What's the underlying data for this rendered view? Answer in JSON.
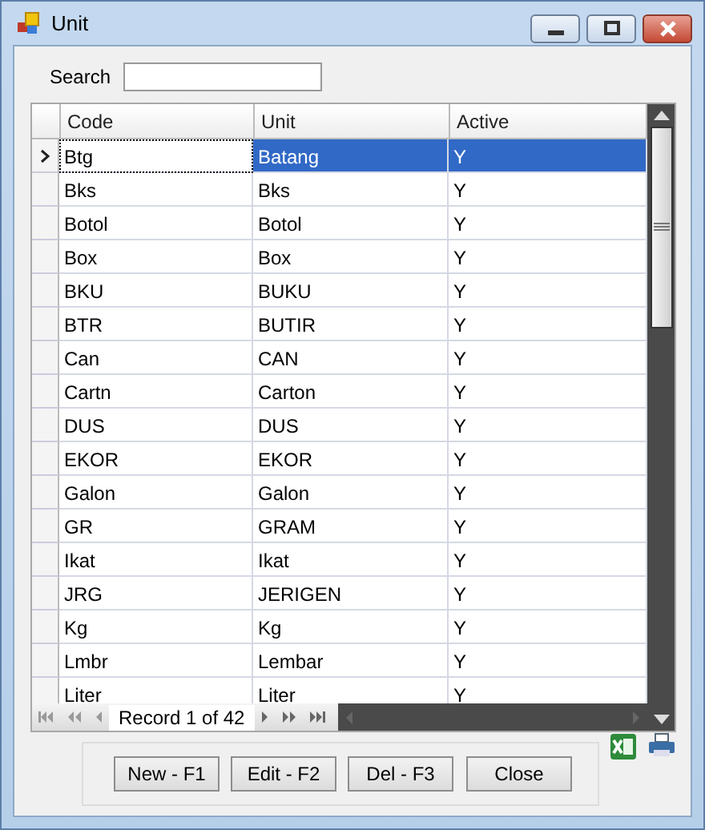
{
  "window": {
    "title": "Unit"
  },
  "search": {
    "label": "Search"
  },
  "table": {
    "columns": [
      "Code",
      "Unit",
      "Active"
    ],
    "rows": [
      {
        "cells": [
          "Btg",
          "Batang",
          "Y"
        ],
        "selected": true
      },
      {
        "cells": [
          "Bks",
          "Bks",
          "Y"
        ],
        "selected": false
      },
      {
        "cells": [
          "Botol",
          "Botol",
          "Y"
        ],
        "selected": false
      },
      {
        "cells": [
          "Box",
          "Box",
          "Y"
        ],
        "selected": false
      },
      {
        "cells": [
          "BKU",
          "BUKU",
          "Y"
        ],
        "selected": false
      },
      {
        "cells": [
          "BTR",
          "BUTIR",
          "Y"
        ],
        "selected": false
      },
      {
        "cells": [
          "Can",
          "CAN",
          "Y"
        ],
        "selected": false
      },
      {
        "cells": [
          "Cartn",
          "Carton",
          "Y"
        ],
        "selected": false
      },
      {
        "cells": [
          "DUS",
          "DUS",
          "Y"
        ],
        "selected": false
      },
      {
        "cells": [
          "EKOR",
          "EKOR",
          "Y"
        ],
        "selected": false
      },
      {
        "cells": [
          "Galon",
          "Galon",
          "Y"
        ],
        "selected": false
      },
      {
        "cells": [
          "GR",
          "GRAM",
          "Y"
        ],
        "selected": false
      },
      {
        "cells": [
          "Ikat",
          "Ikat",
          "Y"
        ],
        "selected": false
      },
      {
        "cells": [
          "JRG",
          "JERIGEN",
          "Y"
        ],
        "selected": false
      },
      {
        "cells": [
          "Kg",
          "Kg",
          "Y"
        ],
        "selected": false
      },
      {
        "cells": [
          "Lmbr",
          "Lembar",
          "Y"
        ],
        "selected": false
      },
      {
        "cells": [
          "Liter",
          "Liter",
          "Y"
        ],
        "selected": false
      }
    ]
  },
  "navigator": {
    "record": "Record 1 of 42"
  },
  "buttons": [
    "New - F1",
    "Edit - F2",
    "Del - F3",
    "Close"
  ]
}
